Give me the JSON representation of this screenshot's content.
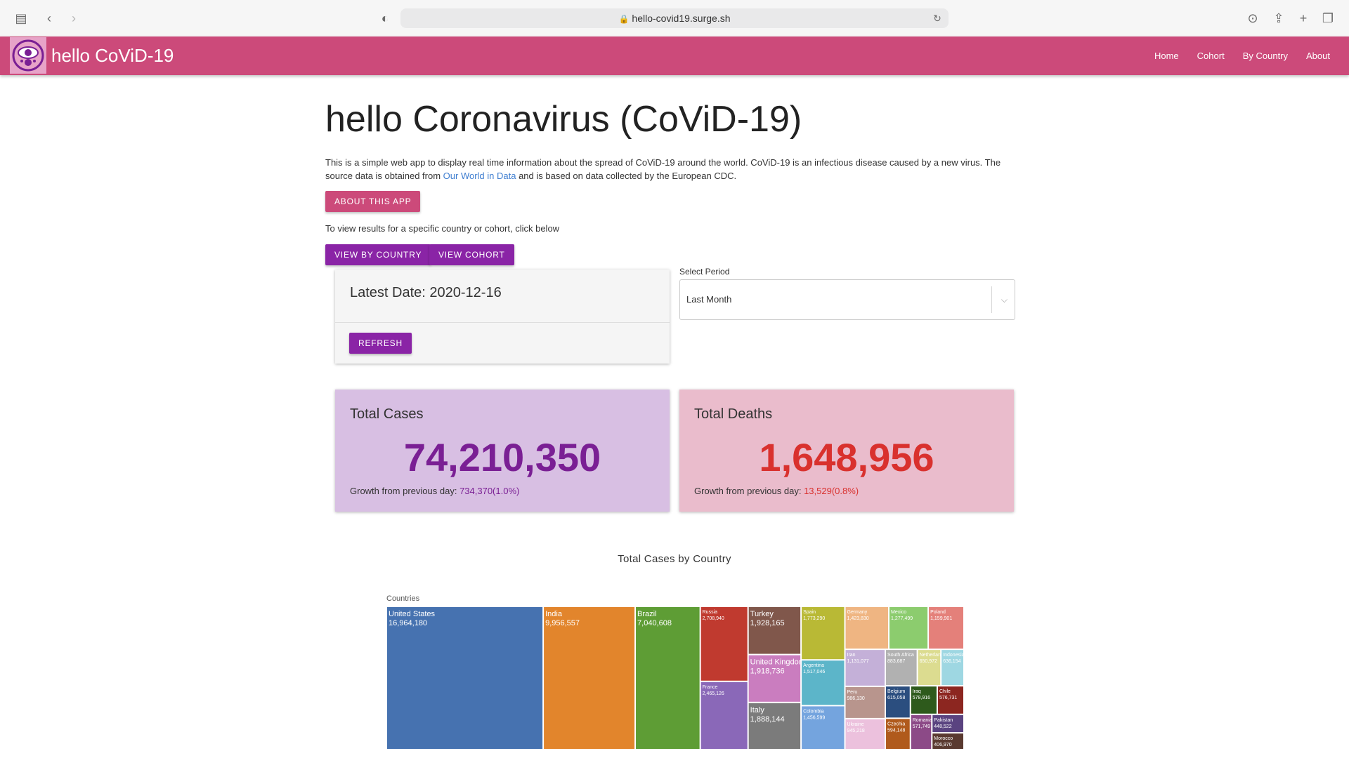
{
  "browser": {
    "url": "hello-covid19.surge.sh"
  },
  "appbar": {
    "brand": "hello CoViD-19",
    "nav": [
      "Home",
      "Cohort",
      "By Country",
      "About"
    ]
  },
  "main": {
    "title": "hello Coronavirus (CoViD-19)",
    "intro_before_link": "This is a simple web app to display real time information about the spread of CoViD-19 around the world. CoViD-19 is an infectious disease caused by a new virus. The source data is obtained from ",
    "intro_link": "Our World in Data",
    "intro_after_link": " and is based on data collected by the European CDC.",
    "about_button": "ABOUT THIS APP",
    "hint": "To view results for a specific country or cohort, click below",
    "by_country_button": "VIEW BY COUNTRY",
    "cohort_button": "VIEW COHORT"
  },
  "latest": {
    "title": "Latest Date: 2020-12-16",
    "refresh_button": "REFRESH"
  },
  "period": {
    "label": "Select Period",
    "value": "Last Month"
  },
  "cases": {
    "label": "Total Cases",
    "value": "74,210,350",
    "growth_label": "Growth from previous day: ",
    "growth_value": "734,370(1.0%)",
    "color": "#7a1f94"
  },
  "deaths": {
    "label": "Total Deaths",
    "value": "1,648,956",
    "growth_label": "Growth from previous day: ",
    "growth_value": "13,529(0.8%)",
    "color": "#d9312e"
  },
  "chart_data": {
    "type": "treemap",
    "title": "Total Cases by Country",
    "root_label": "Countries",
    "items": [
      {
        "name": "United States",
        "value": 16964180,
        "color": "#4672b0"
      },
      {
        "name": "India",
        "value": 9956557,
        "color": "#e2852c"
      },
      {
        "name": "Brazil",
        "value": 7040608,
        "color": "#5e9d35"
      },
      {
        "name": "Russia",
        "value": 2708940,
        "color": "#c03a2f"
      },
      {
        "name": "France",
        "value": 2465126,
        "color": "#8a68b8"
      },
      {
        "name": "Turkey",
        "value": 1928165,
        "color": "#80574b"
      },
      {
        "name": "United Kingdom",
        "value": 1918736,
        "color": "#ca7dbf"
      },
      {
        "name": "Italy",
        "value": 1888144,
        "color": "#7b7b7b"
      },
      {
        "name": "Spain",
        "value": 1773290,
        "color": "#b9b935"
      },
      {
        "name": "Argentina",
        "value": 1517046,
        "color": "#5cb5c9"
      },
      {
        "name": "Colombia",
        "value": 1456599,
        "color": "#74a4de"
      },
      {
        "name": "Germany",
        "value": 1423830,
        "color": "#efb582"
      },
      {
        "name": "Mexico",
        "value": 1277499,
        "color": "#8ccc6e"
      },
      {
        "name": "Poland",
        "value": 1159901,
        "color": "#e4807a"
      },
      {
        "name": "Iran",
        "value": 1131077,
        "color": "#c4b0d8"
      },
      {
        "name": "Peru",
        "value": 986130,
        "color": "#b8958d"
      },
      {
        "name": "Ukraine",
        "value": 945218,
        "color": "#ecc1dd"
      },
      {
        "name": "South Africa",
        "value": 883687,
        "color": "#b1b1b1"
      },
      {
        "name": "Netherlands",
        "value": 650972,
        "color": "#dcdc90"
      },
      {
        "name": "Indonesia",
        "value": 636154,
        "color": "#9ed7e2"
      },
      {
        "name": "Belgium",
        "value": 615058,
        "color": "#2b4e7f"
      },
      {
        "name": "Czechia",
        "value": 594148,
        "color": "#b05a1c"
      },
      {
        "name": "Iraq",
        "value": 578916,
        "color": "#2e5a1c"
      },
      {
        "name": "Chile",
        "value": 576731,
        "color": "#8c2620"
      },
      {
        "name": "Pakistan",
        "value": 448522,
        "color": "#5a4380"
      },
      {
        "name": "Morocco",
        "value": 406970,
        "color": "#5a3a30"
      },
      {
        "name": "Romania",
        "value": 571749,
        "color": "#8c4a87"
      }
    ]
  }
}
